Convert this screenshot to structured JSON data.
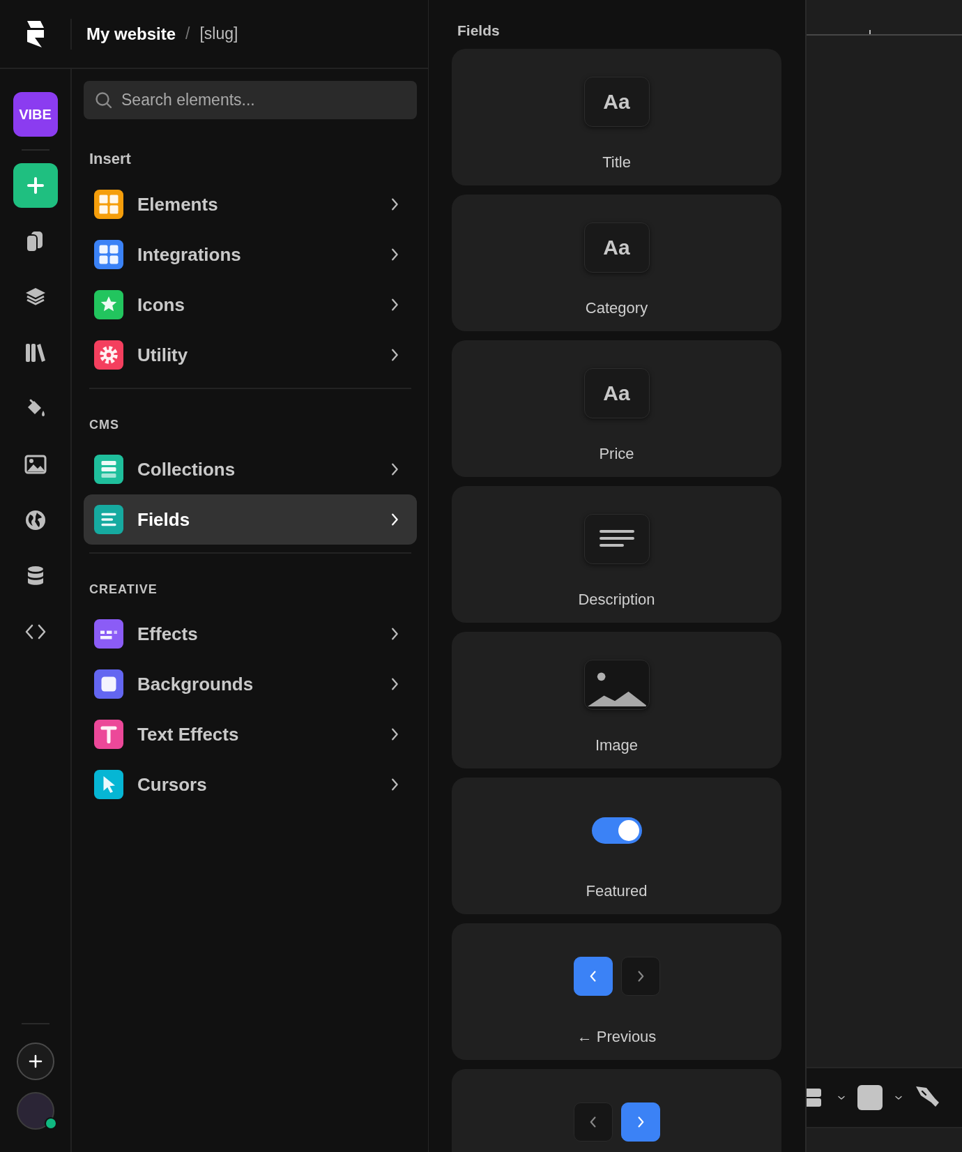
{
  "header": {
    "site": "My website",
    "separator": "/",
    "page": "[slug]"
  },
  "rail": {
    "vibe": "VIBE"
  },
  "search": {
    "placeholder": "Search elements..."
  },
  "sections": [
    {
      "title": "Insert",
      "kind": "heading",
      "items": [
        {
          "label": "Elements",
          "color": "#f59e0b",
          "selected": false
        },
        {
          "label": "Integrations",
          "color": "#3b82f6",
          "selected": false
        },
        {
          "label": "Icons",
          "color": "#22c55e",
          "selected": false
        },
        {
          "label": "Utility",
          "color": "#f43f5e",
          "selected": false
        }
      ]
    },
    {
      "title": "CMS",
      "kind": "group",
      "items": [
        {
          "label": "Collections",
          "color": "#1fbf9c",
          "selected": false
        },
        {
          "label": "Fields",
          "color": "#16aaa0",
          "selected": true
        }
      ]
    },
    {
      "title": "CREATIVE",
      "kind": "group",
      "items": [
        {
          "label": "Effects",
          "color": "#8b5cf6",
          "selected": false
        },
        {
          "label": "Backgrounds",
          "color": "#6366f1",
          "selected": false
        },
        {
          "label": "Text Effects",
          "color": "#ec4899",
          "selected": false
        },
        {
          "label": "Cursors",
          "color": "#06b6d4",
          "selected": false
        }
      ]
    }
  ],
  "fields_panel": {
    "title": "Fields",
    "cards": [
      {
        "kind": "text",
        "glyph": "Aa",
        "label": "Title"
      },
      {
        "kind": "text",
        "glyph": "Aa",
        "label": "Category"
      },
      {
        "kind": "text",
        "glyph": "Aa",
        "label": "Price"
      },
      {
        "kind": "lines",
        "label": "Description"
      },
      {
        "kind": "image",
        "label": "Image"
      },
      {
        "kind": "toggle",
        "on": true,
        "label": "Featured"
      },
      {
        "kind": "pager",
        "buttons": [
          {
            "selected": true
          },
          {
            "selected": false
          }
        ],
        "label": "← Previous"
      },
      {
        "kind": "pager",
        "buttons": [
          {
            "selected": false
          },
          {
            "selected": true
          }
        ]
      }
    ]
  }
}
